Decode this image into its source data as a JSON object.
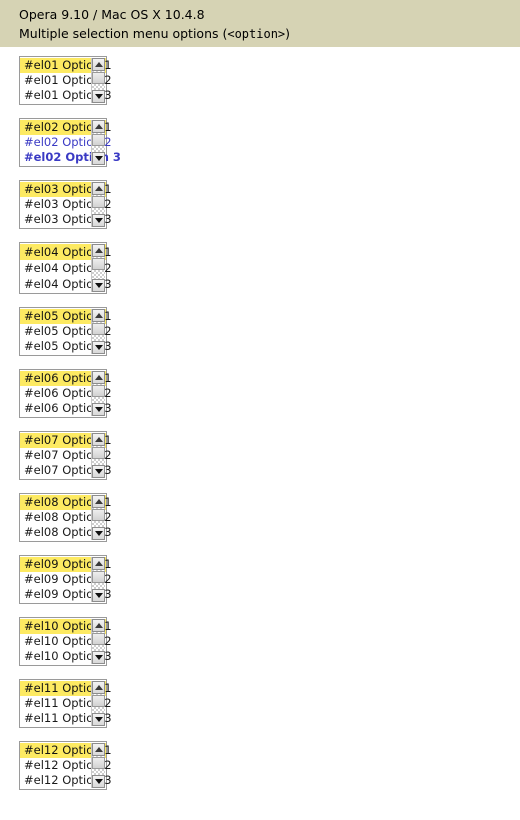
{
  "header": {
    "line1": "Opera 9.10 / Mac OS X 10.4.8",
    "line2_prefix": "Multiple selection menu options (",
    "line2_code": "<option>",
    "line2_suffix": ")"
  },
  "colors": {
    "header_background": "#d6d3b4",
    "page_background": "#ffffff",
    "selected_option_background": "#fdea62",
    "option_text": "#1a1a1a",
    "blue_option_text": "#3a3ac4",
    "listbox_border": "#9a9a9a",
    "scrollbar_button": "#e6e6e6"
  },
  "listboxes": [
    {
      "id": "el01",
      "variant": "default",
      "scrollbar": {
        "up_icon": "triangle-up-icon",
        "down_icon": "triangle-down-icon",
        "thumb": "scrollbar-thumb"
      },
      "options": [
        {
          "label": "#el01 Option 1",
          "selected": true,
          "style": "normal"
        },
        {
          "label": "#el01 Option 2",
          "selected": false,
          "style": "normal"
        },
        {
          "label": "#el01 Option 3",
          "selected": false,
          "style": "normal"
        }
      ]
    },
    {
      "id": "el02",
      "variant": "default",
      "scrollbar": {
        "up_icon": "triangle-up-icon",
        "down_icon": "triangle-down-icon",
        "thumb": "scrollbar-thumb"
      },
      "options": [
        {
          "label": "#el02 Option 1",
          "selected": true,
          "style": "normal"
        },
        {
          "label": "#el02 Option 2",
          "selected": false,
          "style": "blue"
        },
        {
          "label": "#el02 Option 3",
          "selected": false,
          "style": "blue-bold"
        }
      ]
    },
    {
      "id": "el03",
      "variant": "default",
      "scrollbar": {
        "up_icon": "triangle-up-icon",
        "down_icon": "triangle-down-icon",
        "thumb": "scrollbar-thumb"
      },
      "options": [
        {
          "label": "#el03 Option 1",
          "selected": true,
          "style": "normal"
        },
        {
          "label": "#el03 Option 2",
          "selected": false,
          "style": "normal"
        },
        {
          "label": "#el03 Option 3",
          "selected": false,
          "style": "normal"
        }
      ]
    },
    {
      "id": "el04",
      "variant": "tall",
      "scrollbar": {
        "up_icon": "triangle-up-icon",
        "down_icon": "triangle-down-icon",
        "thumb": "scrollbar-thumb"
      },
      "options": [
        {
          "label": "#el04 Option 1",
          "selected": true,
          "style": "normal"
        },
        {
          "label": "#el04 Option 2",
          "selected": false,
          "style": "normal"
        },
        {
          "label": "#el04 Option 3",
          "selected": false,
          "style": "normal"
        }
      ]
    },
    {
      "id": "el05",
      "variant": "default",
      "scrollbar": {
        "up_icon": "triangle-up-icon",
        "down_icon": "triangle-down-icon",
        "thumb": "scrollbar-thumb"
      },
      "options": [
        {
          "label": "#el05 Option 1",
          "selected": true,
          "style": "normal"
        },
        {
          "label": "#el05 Option 2",
          "selected": false,
          "style": "normal"
        },
        {
          "label": "#el05 Option 3",
          "selected": false,
          "style": "normal"
        }
      ]
    },
    {
      "id": "el06",
      "variant": "default",
      "scrollbar": {
        "up_icon": "triangle-up-icon",
        "down_icon": "triangle-down-icon",
        "thumb": "scrollbar-thumb"
      },
      "options": [
        {
          "label": "#el06 Option 1",
          "selected": true,
          "style": "normal"
        },
        {
          "label": "#el06 Option 2",
          "selected": false,
          "style": "normal"
        },
        {
          "label": "#el06 Option 3",
          "selected": false,
          "style": "normal"
        }
      ]
    },
    {
      "id": "el07",
      "variant": "default",
      "scrollbar": {
        "up_icon": "triangle-up-icon",
        "down_icon": "triangle-down-icon",
        "thumb": "scrollbar-thumb"
      },
      "options": [
        {
          "label": "#el07 Option 1",
          "selected": true,
          "style": "normal"
        },
        {
          "label": "#el07 Option 2",
          "selected": false,
          "style": "normal"
        },
        {
          "label": "#el07 Option 3",
          "selected": false,
          "style": "normal"
        }
      ]
    },
    {
      "id": "el08",
      "variant": "default",
      "scrollbar": {
        "up_icon": "triangle-up-icon",
        "down_icon": "triangle-down-icon",
        "thumb": "scrollbar-thumb"
      },
      "options": [
        {
          "label": "#el08 Option 1",
          "selected": true,
          "style": "normal"
        },
        {
          "label": "#el08 Option 2",
          "selected": false,
          "style": "normal"
        },
        {
          "label": "#el08 Option 3",
          "selected": false,
          "style": "normal"
        }
      ]
    },
    {
      "id": "el09",
      "variant": "default",
      "scrollbar": {
        "up_icon": "triangle-up-icon",
        "down_icon": "triangle-down-icon",
        "thumb": "scrollbar-thumb"
      },
      "options": [
        {
          "label": "#el09 Option 1",
          "selected": true,
          "style": "normal"
        },
        {
          "label": "#el09 Option 2",
          "selected": false,
          "style": "normal"
        },
        {
          "label": "#el09 Option 3",
          "selected": false,
          "style": "normal"
        }
      ]
    },
    {
      "id": "el10",
      "variant": "default",
      "scrollbar": {
        "up_icon": "triangle-up-icon",
        "down_icon": "triangle-down-icon",
        "thumb": "scrollbar-thumb"
      },
      "options": [
        {
          "label": "#el10 Option 1",
          "selected": true,
          "style": "normal"
        },
        {
          "label": "#el10 Option 2",
          "selected": false,
          "style": "normal"
        },
        {
          "label": "#el10 Option 3",
          "selected": false,
          "style": "normal"
        }
      ]
    },
    {
      "id": "el11",
      "variant": "default",
      "scrollbar": {
        "up_icon": "triangle-up-icon",
        "down_icon": "triangle-down-icon",
        "thumb": "scrollbar-thumb"
      },
      "options": [
        {
          "label": "#el11 Option 1",
          "selected": true,
          "style": "normal"
        },
        {
          "label": "#el11 Option 2",
          "selected": false,
          "style": "normal"
        },
        {
          "label": "#el11 Option 3",
          "selected": false,
          "style": "normal"
        }
      ]
    },
    {
      "id": "el12",
      "variant": "default",
      "scrollbar": {
        "up_icon": "triangle-up-icon",
        "down_icon": "triangle-down-icon",
        "thumb": "scrollbar-thumb"
      },
      "options": [
        {
          "label": "#el12 Option 1",
          "selected": true,
          "style": "normal"
        },
        {
          "label": "#el12 Option 2",
          "selected": false,
          "style": "normal"
        },
        {
          "label": "#el12 Option 3",
          "selected": false,
          "style": "normal"
        }
      ]
    }
  ]
}
